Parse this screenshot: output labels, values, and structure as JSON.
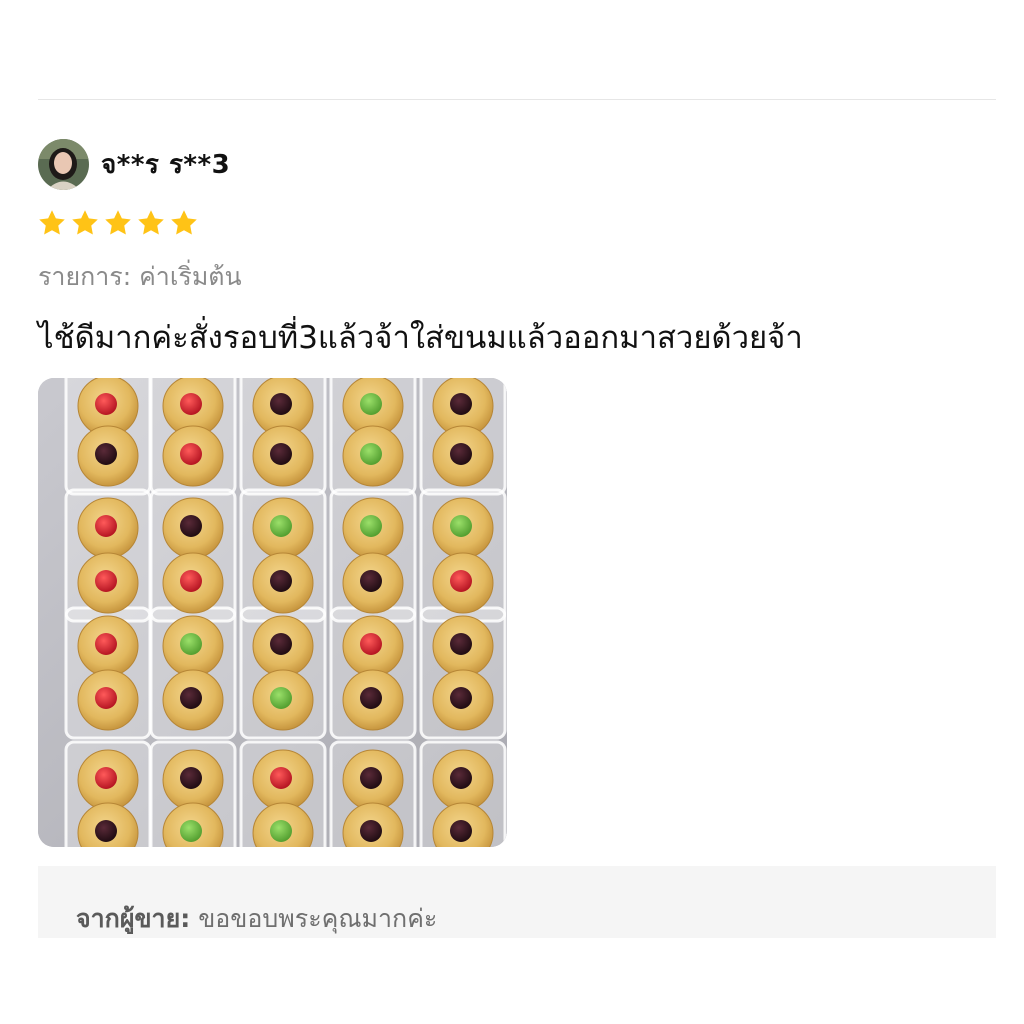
{
  "review": {
    "reviewer_name": "จ**ร ร**3",
    "rating": 5,
    "rating_max": 5,
    "star_color": "#FFC316",
    "variation": "รายการ: ค่าเริ่มต้น",
    "text": "ไช้ดีมากค่ะสั่งรอบที่3แล้วจ้าใส่ขนมแล้วออกมาสวยด้วยจ้า",
    "photo": {
      "subject": "thumbprint cookies with jam in clear plastic boxes",
      "jam_colors": [
        "#c8192a",
        "#2a1018",
        "#6db33f"
      ]
    }
  },
  "seller_reply": {
    "label": "จากผู้ขาย:",
    "text": "ขอขอบพระคุณมากค่ะ"
  }
}
